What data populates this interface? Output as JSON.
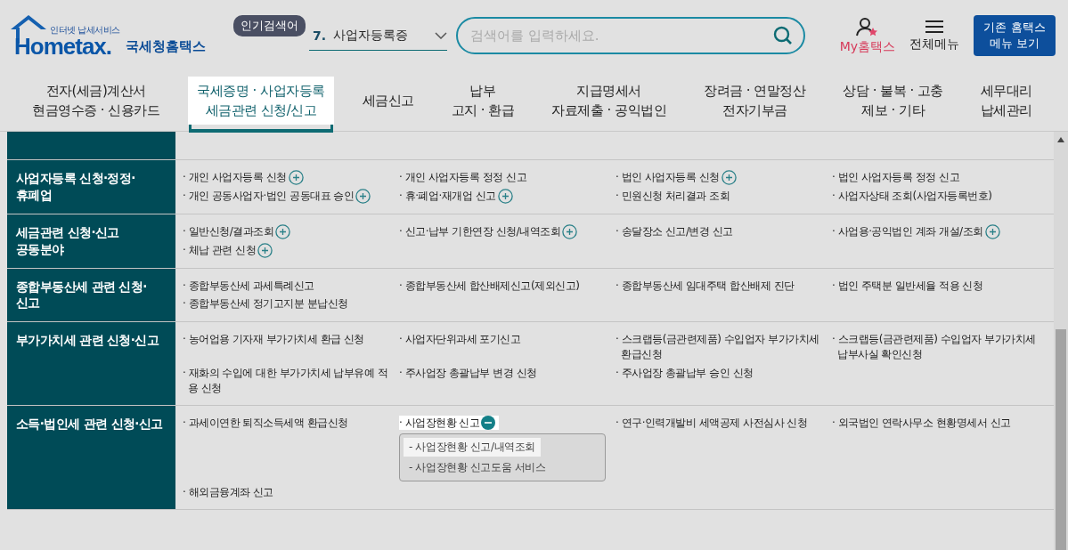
{
  "logo": {
    "tagline": "인터넷 납세서비스",
    "wordmark": "Hometax.",
    "name": "국세청홈택스"
  },
  "popular_search": {
    "badge": "인기검색어",
    "rank": "7.",
    "term": "사업자등록증"
  },
  "search": {
    "placeholder": "검색어를 입력하세요."
  },
  "utilities": [
    {
      "kind": "my",
      "label": "My홈택스"
    },
    {
      "kind": "menu",
      "label": "전체메뉴"
    }
  ],
  "legacy_button": "기존 홈택스\n메뉴 보기",
  "nav": [
    {
      "label": "전자(세금)계산서\n현금영수증 · 신용카드",
      "selected": false
    },
    {
      "label": "국세증명 · 사업자등록\n세금관련 신청/신고",
      "selected": true
    },
    {
      "label": "세금신고",
      "selected": false
    },
    {
      "label": "납부\n고지 · 환급",
      "selected": false
    },
    {
      "label": "지급명세서\n자료제출 · 공익법인",
      "selected": false
    },
    {
      "label": "장려금 · 연말정산\n전자기부금",
      "selected": false
    },
    {
      "label": "상담 · 불복 · 고충\n제보 · 기타",
      "selected": false
    },
    {
      "label": "세무대리\n납세관리",
      "selected": false
    }
  ],
  "sections": [
    {
      "title": "사업자등록 신청·정정·\n휴폐업",
      "items": [
        {
          "text": "· 개인 사업자등록 신청",
          "kind": "toggle",
          "expanded": false
        },
        {
          "text": "· 개인 사업자등록 정정 신고",
          "kind": "plain"
        },
        {
          "text": "· 법인 사업자등록 신청",
          "kind": "toggle",
          "expanded": false
        },
        {
          "text": "· 법인 사업자등록 정정 신고",
          "kind": "plain"
        },
        {
          "text": "· 개인 공동사업자·법인 공동대표 승인",
          "kind": "toggle",
          "expanded": false
        },
        {
          "text": "· 휴·폐업·재개업 신고",
          "kind": "toggle",
          "expanded": false
        },
        {
          "text": "· 민원신청 처리결과 조회",
          "kind": "plain"
        },
        {
          "text": "· 사업자상태 조회(사업자등록번호)",
          "kind": "plain"
        }
      ]
    },
    {
      "title": "세금관련 신청·신고\n공동분야",
      "items": [
        {
          "text": "· 일반신청/결과조회",
          "kind": "toggle",
          "expanded": false
        },
        {
          "text": "· 신고·납부 기한연장 신청/내역조회",
          "kind": "toggle",
          "expanded": false
        },
        {
          "text": "· 송달장소 신고/변경 신고",
          "kind": "plain"
        },
        {
          "text": "· 사업용·공익법인 계좌 개설/조회",
          "kind": "toggle",
          "expanded": false
        },
        {
          "text": "· 체납 관련 신청",
          "kind": "toggle",
          "expanded": false
        }
      ]
    },
    {
      "title": "종합부동산세 관련 신청·\n신고",
      "items": [
        {
          "text": "· 종합부동산세 과세특례신고",
          "kind": "plain"
        },
        {
          "text": "· 종합부동산세 합산배제신고(제외신고)",
          "kind": "plain"
        },
        {
          "text": "· 종합부동산세 임대주택 합산배제 진단",
          "kind": "plain"
        },
        {
          "text": "· 법인 주택분 일반세율 적용 신청",
          "kind": "plain"
        },
        {
          "text": "· 종합부동산세 정기고지분 분납신청",
          "kind": "plain"
        }
      ]
    },
    {
      "title": "부가가치세 관련 신청·신고",
      "items": [
        {
          "text": "· 농어업용 기자재 부가가치세 환급 신청",
          "kind": "plain"
        },
        {
          "text": "· 사업자단위과세 포기신고",
          "kind": "plain"
        },
        {
          "text": "· 스크랩등(금관련제품) 수입업자 부가가치세 환급신청",
          "kind": "plain"
        },
        {
          "text": "· 스크랩등(금관련제품) 수입업자 부가가치세 납부사실 확인신청",
          "kind": "plain"
        },
        {
          "text": "· 재화의 수입에 대한 부가가치세 납부유예 적용 신청",
          "kind": "plain"
        },
        {
          "text": "· 주사업장 총괄납부 변경 신청",
          "kind": "plain"
        },
        {
          "text": "· 주사업장 총괄납부 승인 신청",
          "kind": "plain"
        }
      ]
    },
    {
      "title": "소득·법인세 관련 신청·신고",
      "items": [
        {
          "text": "· 과세이연한 퇴직소득세액 환급신청",
          "kind": "plain"
        },
        {
          "text": "· 사업장현황 신고",
          "kind": "toggle",
          "expanded": true,
          "children": [
            {
              "text": "- 사업장현황 신고/내역조회",
              "selected": true
            },
            {
              "text": "- 사업장현황 신고도움 서비스",
              "selected": false
            }
          ]
        },
        {
          "text": "· 연구·인력개발비 세액공제 사전심사 신청",
          "kind": "plain"
        },
        {
          "text": "· 외국법인 연락사무소 현황명세서 신고",
          "kind": "plain"
        },
        {
          "text": "· 해외금융계좌 신고",
          "kind": "plain"
        }
      ]
    }
  ]
}
